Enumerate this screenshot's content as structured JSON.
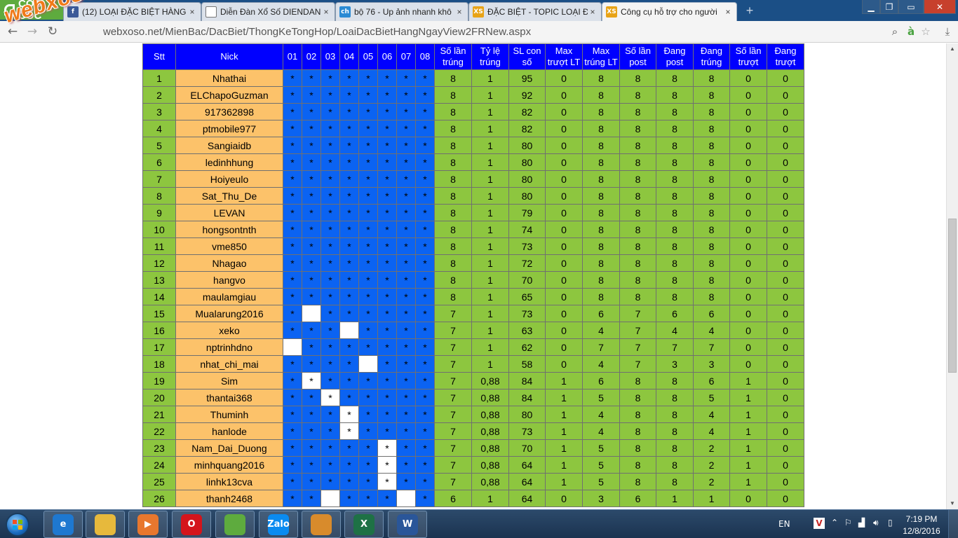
{
  "browser": {
    "brand": "CỐC CỐC",
    "tabs": [
      {
        "title": "(12) LOẠI ĐẶC BIỆT HÀNG",
        "favicon": "facebook-icon",
        "favicon_text": "f",
        "color": "#3b5998"
      },
      {
        "title": "Diễn Đàn Xổ Số DIENDAN",
        "favicon": "page-icon",
        "favicon_text": "",
        "color": "#ffffff"
      },
      {
        "title": "bộ 76 - Up ảnh nhanh khô",
        "favicon": "ch-icon",
        "favicon_text": "ch",
        "color": "#2a8ad4"
      },
      {
        "title": "ĐẶC BIỆT - TOPIC LOẠI ĐẶ",
        "favicon": "xs-icon",
        "favicon_text": "XS",
        "color": "#e8a317"
      },
      {
        "title": "Công cụ hỗ trợ cho người",
        "favicon": "xs-icon",
        "favicon_text": "XS",
        "color": "#e8a317"
      }
    ],
    "url": "webxoso.net/MienBac/DacBiet/ThongKeTongHop/LoaiDacBietHangNgayView2FRNew.aspx",
    "watermark": "webxoso.net"
  },
  "table": {
    "headers": [
      "Stt",
      "Nick",
      "01",
      "02",
      "03",
      "04",
      "05",
      "06",
      "07",
      "08",
      "Số lần trúng",
      "Tỷ lệ trúng",
      "SL con số",
      "Max trượt LT",
      "Max trúng LT",
      "Số lần post",
      "Đang post",
      "Đang trúng",
      "Số lần trượt",
      "Đang trượt"
    ],
    "rows": [
      {
        "stt": "1",
        "nick": "Nhathai",
        "cells": [
          "*",
          "*",
          "*",
          "*",
          "*",
          "*",
          "*",
          "*"
        ],
        "stats": [
          "8",
          "1",
          "95",
          "0",
          "8",
          "8",
          "8",
          "8",
          "0",
          "0"
        ]
      },
      {
        "stt": "2",
        "nick": "ELChapoGuzman",
        "cells": [
          "*",
          "*",
          "*",
          "*",
          "*",
          "*",
          "*",
          "*"
        ],
        "stats": [
          "8",
          "1",
          "92",
          "0",
          "8",
          "8",
          "8",
          "8",
          "0",
          "0"
        ]
      },
      {
        "stt": "3",
        "nick": "917362898",
        "cells": [
          "*",
          "*",
          "*",
          "*",
          "*",
          "*",
          "*",
          "*"
        ],
        "stats": [
          "8",
          "1",
          "82",
          "0",
          "8",
          "8",
          "8",
          "8",
          "0",
          "0"
        ]
      },
      {
        "stt": "4",
        "nick": "ptmobile977",
        "cells": [
          "*",
          "*",
          "*",
          "*",
          "*",
          "*",
          "*",
          "*"
        ],
        "stats": [
          "8",
          "1",
          "82",
          "0",
          "8",
          "8",
          "8",
          "8",
          "0",
          "0"
        ]
      },
      {
        "stt": "5",
        "nick": "Sangiaidb",
        "cells": [
          "*",
          "*",
          "*",
          "*",
          "*",
          "*",
          "*",
          "*"
        ],
        "stats": [
          "8",
          "1",
          "80",
          "0",
          "8",
          "8",
          "8",
          "8",
          "0",
          "0"
        ]
      },
      {
        "stt": "6",
        "nick": "ledinhhung",
        "cells": [
          "*",
          "*",
          "*",
          "*",
          "*",
          "*",
          "*",
          "*"
        ],
        "stats": [
          "8",
          "1",
          "80",
          "0",
          "8",
          "8",
          "8",
          "8",
          "0",
          "0"
        ]
      },
      {
        "stt": "7",
        "nick": "Hoiyeulo",
        "cells": [
          "*",
          "*",
          "*",
          "*",
          "*",
          "*",
          "*",
          "*"
        ],
        "stats": [
          "8",
          "1",
          "80",
          "0",
          "8",
          "8",
          "8",
          "8",
          "0",
          "0"
        ]
      },
      {
        "stt": "8",
        "nick": "Sat_Thu_De",
        "cells": [
          "*",
          "*",
          "*",
          "*",
          "*",
          "*",
          "*",
          "*"
        ],
        "stats": [
          "8",
          "1",
          "80",
          "0",
          "8",
          "8",
          "8",
          "8",
          "0",
          "0"
        ]
      },
      {
        "stt": "9",
        "nick": "LEVAN",
        "cells": [
          "*",
          "*",
          "*",
          "*",
          "*",
          "*",
          "*",
          "*"
        ],
        "stats": [
          "8",
          "1",
          "79",
          "0",
          "8",
          "8",
          "8",
          "8",
          "0",
          "0"
        ]
      },
      {
        "stt": "10",
        "nick": "hongsontnth",
        "cells": [
          "*",
          "*",
          "*",
          "*",
          "*",
          "*",
          "*",
          "*"
        ],
        "stats": [
          "8",
          "1",
          "74",
          "0",
          "8",
          "8",
          "8",
          "8",
          "0",
          "0"
        ]
      },
      {
        "stt": "11",
        "nick": "vme850",
        "cells": [
          "*",
          "*",
          "*",
          "*",
          "*",
          "*",
          "*",
          "*"
        ],
        "stats": [
          "8",
          "1",
          "73",
          "0",
          "8",
          "8",
          "8",
          "8",
          "0",
          "0"
        ]
      },
      {
        "stt": "12",
        "nick": "Nhagao",
        "cells": [
          "*",
          "*",
          "*",
          "*",
          "*",
          "*",
          "*",
          "*"
        ],
        "stats": [
          "8",
          "1",
          "72",
          "0",
          "8",
          "8",
          "8",
          "8",
          "0",
          "0"
        ]
      },
      {
        "stt": "13",
        "nick": "hangvo",
        "cells": [
          "*",
          "*",
          "*",
          "*",
          "*",
          "*",
          "*",
          "*"
        ],
        "stats": [
          "8",
          "1",
          "70",
          "0",
          "8",
          "8",
          "8",
          "8",
          "0",
          "0"
        ]
      },
      {
        "stt": "14",
        "nick": "maulamgiau",
        "cells": [
          "*",
          "*",
          "*",
          "*",
          "*",
          "*",
          "*",
          "*"
        ],
        "stats": [
          "8",
          "1",
          "65",
          "0",
          "8",
          "8",
          "8",
          "8",
          "0",
          "0"
        ]
      },
      {
        "stt": "15",
        "nick": "Mualarung2016",
        "cells": [
          "*",
          "#",
          "*",
          "*",
          "*",
          "*",
          "*",
          "*"
        ],
        "stats": [
          "7",
          "1",
          "73",
          "0",
          "6",
          "7",
          "6",
          "6",
          "0",
          "0"
        ]
      },
      {
        "stt": "16",
        "nick": "xeko",
        "cells": [
          "*",
          "*",
          "*",
          "#",
          "*",
          "*",
          "*",
          "*"
        ],
        "stats": [
          "7",
          "1",
          "63",
          "0",
          "4",
          "7",
          "4",
          "4",
          "0",
          "0"
        ]
      },
      {
        "stt": "17",
        "nick": "nptrinhdno",
        "cells": [
          "#",
          "*",
          "*",
          "*",
          "*",
          "*",
          "*",
          "*"
        ],
        "stats": [
          "7",
          "1",
          "62",
          "0",
          "7",
          "7",
          "7",
          "7",
          "0",
          "0"
        ]
      },
      {
        "stt": "18",
        "nick": "nhat_chi_mai",
        "cells": [
          "*",
          "*",
          "*",
          "*",
          "#",
          "*",
          "*",
          "*"
        ],
        "stats": [
          "7",
          "1",
          "58",
          "0",
          "4",
          "7",
          "3",
          "3",
          "0",
          "0"
        ]
      },
      {
        "stt": "19",
        "nick": "Sim",
        "cells": [
          "*",
          "w*",
          "*",
          "*",
          "*",
          "*",
          "*",
          "*"
        ],
        "stats": [
          "7",
          "0,88",
          "84",
          "1",
          "6",
          "8",
          "8",
          "6",
          "1",
          "0"
        ]
      },
      {
        "stt": "20",
        "nick": "thantai368",
        "cells": [
          "*",
          "*",
          "w*",
          "*",
          "*",
          "*",
          "*",
          "*"
        ],
        "stats": [
          "7",
          "0,88",
          "84",
          "1",
          "5",
          "8",
          "8",
          "5",
          "1",
          "0"
        ]
      },
      {
        "stt": "21",
        "nick": "Thuminh",
        "cells": [
          "*",
          "*",
          "*",
          "w*",
          "*",
          "*",
          "*",
          "*"
        ],
        "stats": [
          "7",
          "0,88",
          "80",
          "1",
          "4",
          "8",
          "8",
          "4",
          "1",
          "0"
        ]
      },
      {
        "stt": "22",
        "nick": "hanlode",
        "cells": [
          "*",
          "*",
          "*",
          "w*",
          "*",
          "*",
          "*",
          "*"
        ],
        "stats": [
          "7",
          "0,88",
          "73",
          "1",
          "4",
          "8",
          "8",
          "4",
          "1",
          "0"
        ]
      },
      {
        "stt": "23",
        "nick": "Nam_Dai_Duong",
        "cells": [
          "*",
          "*",
          "*",
          "*",
          "*",
          "w*",
          "*",
          "*"
        ],
        "stats": [
          "7",
          "0,88",
          "70",
          "1",
          "5",
          "8",
          "8",
          "2",
          "1",
          "0"
        ]
      },
      {
        "stt": "24",
        "nick": "minhquang2016",
        "cells": [
          "*",
          "*",
          "*",
          "*",
          "*",
          "w*",
          "*",
          "*"
        ],
        "stats": [
          "7",
          "0,88",
          "64",
          "1",
          "5",
          "8",
          "8",
          "2",
          "1",
          "0"
        ]
      },
      {
        "stt": "25",
        "nick": "linhk13cva",
        "cells": [
          "*",
          "*",
          "*",
          "*",
          "*",
          "w*",
          "*",
          "*"
        ],
        "stats": [
          "7",
          "0,88",
          "64",
          "1",
          "5",
          "8",
          "8",
          "2",
          "1",
          "0"
        ]
      },
      {
        "stt": "26",
        "nick": "thanh2468",
        "cells": [
          "*",
          "*",
          "#",
          "*",
          "*",
          "*",
          "#",
          "*"
        ],
        "stats": [
          "6",
          "1",
          "64",
          "0",
          "3",
          "6",
          "1",
          "1",
          "0",
          "0"
        ]
      }
    ]
  },
  "taskbar": {
    "apps": [
      {
        "name": "ie-icon",
        "label": "e",
        "color": "#1e78d0"
      },
      {
        "name": "file-explorer-icon",
        "label": "",
        "color": "#e7b93c"
      },
      {
        "name": "media-player-icon",
        "label": "▶",
        "color": "#e8772e"
      },
      {
        "name": "opera-icon",
        "label": "O",
        "color": "#d4151c"
      },
      {
        "name": "coccoc-icon",
        "label": "",
        "color": "#5eab3e"
      },
      {
        "name": "zalo-icon",
        "label": "Zalo",
        "color": "#0a8bf0"
      },
      {
        "name": "paint-icon",
        "label": "",
        "color": "#d88b2c"
      },
      {
        "name": "excel-icon",
        "label": "X",
        "color": "#1e7145"
      },
      {
        "name": "word-icon",
        "label": "W",
        "color": "#2a5699"
      }
    ],
    "language": "EN",
    "time": "7:19 PM",
    "date": "12/8/2016"
  }
}
